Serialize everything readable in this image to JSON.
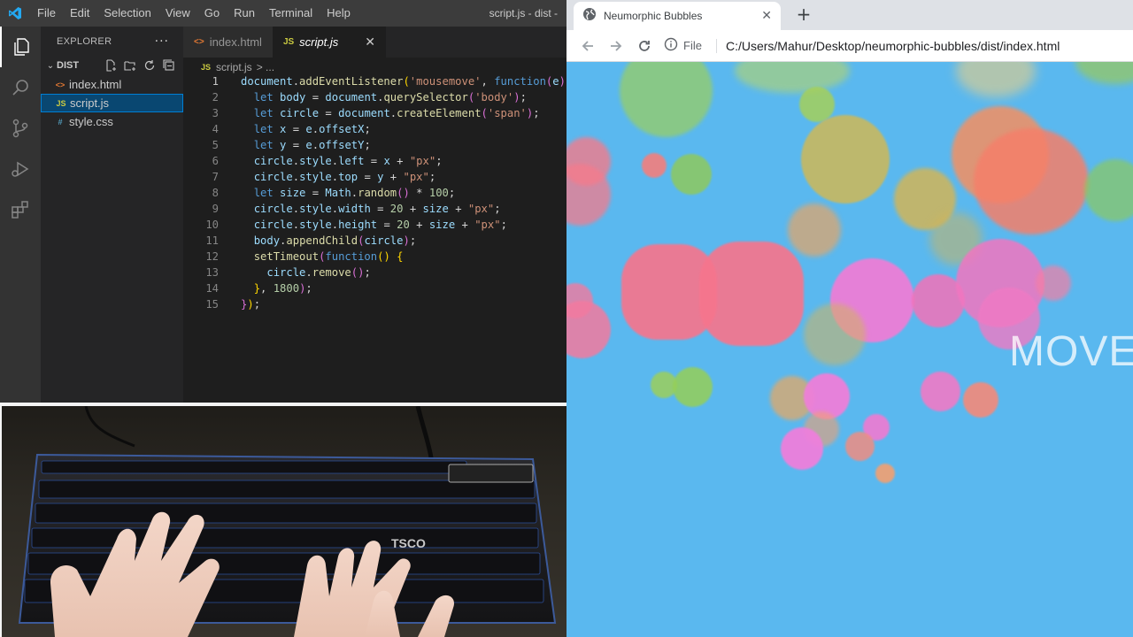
{
  "vscode": {
    "window_title": "script.js - dist -",
    "menu": [
      "File",
      "Edit",
      "Selection",
      "View",
      "Go",
      "Run",
      "Terminal",
      "Help"
    ],
    "explorer": {
      "title": "EXPLORER",
      "more": "···",
      "folder": "DIST",
      "files": [
        {
          "icon": "<>",
          "name": "index.html",
          "color": "#e37933"
        },
        {
          "icon": "JS",
          "name": "script.js",
          "color": "#cbcb41"
        },
        {
          "icon": "#",
          "name": "style.css",
          "color": "#519aba"
        }
      ]
    },
    "tabs": [
      {
        "icon": "<>",
        "label": "index.html",
        "color": "#e37933"
      },
      {
        "icon": "JS",
        "label": "script.js",
        "color": "#cbcb41"
      }
    ],
    "breadcrumb": {
      "icon": "JS",
      "file": "script.js",
      "rest": "> ..."
    },
    "line_numbers": [
      "1",
      "2",
      "3",
      "4",
      "5",
      "6",
      "7",
      "8",
      "9",
      "10",
      "11",
      "12",
      "13",
      "14",
      "15"
    ]
  },
  "browser": {
    "tab_title": "Neumorphic Bubbles",
    "new_tab": "+",
    "info_label": "File",
    "url": "C:/Users/Mahur/Desktop/neumorphic-bubbles/dist/index.html",
    "page_text": "MOVE",
    "page_bg": "#5ab8ef"
  }
}
